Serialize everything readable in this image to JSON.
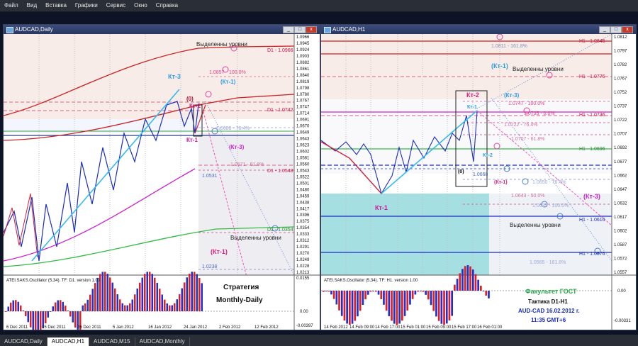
{
  "menu": [
    "Файл",
    "Вид",
    "Вставка",
    "Графики",
    "Сервис",
    "Окно",
    "Справка"
  ],
  "left": {
    "title": "AUDCAD,Daily",
    "price_labels": [
      "1.0966",
      "1.0945",
      "1.0924",
      "1.0903",
      "1.0882",
      "1.0861",
      "1.0840",
      "1.0819",
      "1.0798",
      "1.0780",
      "1.0767",
      "1.0747",
      "1.0714",
      "1.0691",
      "1.0670",
      "1.0649",
      "1.0643",
      "1.0623",
      "1.0602",
      "1.0581",
      "1.0560",
      "1.0543",
      "1.0522",
      "1.0501",
      "1.0480",
      "1.0459",
      "1.0438",
      "1.0417",
      "1.0396",
      "1.0375",
      "1.0354",
      "1.0333",
      "1.0312",
      "1.0291",
      "1.0270",
      "1.0249",
      "1.0228",
      "1.0213"
    ],
    "date_labels": [
      "6 Dec 2011",
      "15 Dec 2011",
      "26 Dec 2011",
      "5 Jan 2012",
      "16 Jan 2012",
      "24 Jan 2012",
      "2 Feb 2012",
      "12 Feb 2012"
    ],
    "ann": {
      "vydelen_top": "Выделенны уровни",
      "d1_0966": "D1 - 1.0966",
      "val_0857": "1.0857",
      "pct_100": "100.0%",
      "kt3": "Кт-3",
      "kt1_cyan": "(Кт-1)",
      "o_label": "(0)",
      "kt2": "Кт-2",
      "d1_0742": "D1 - 1.0742",
      "val_0680": "1.0680 - 76.4%",
      "kt1_mag": "Кт-1",
      "kt3_paren": "(Кт-3)",
      "val_0571": "1.0571 - 61.8%",
      "d1_0548": "D1 - 1.0548",
      "val_0531": "1.0531",
      "d1_0354": "D1 - 1.0354",
      "vydelen_bot": "Выделенны уровни",
      "kt1_paren": "(Кт-1)",
      "val_0238": "1.0238"
    },
    "osc_title": "ATEI.SAKS.Oscillator (5,34). TF: D1. version 1.00",
    "osc_scale": [
      "0.0155",
      "0.00",
      "-0.00397"
    ],
    "strategy1": "Стратегия",
    "strategy2": "Monthly-Daily"
  },
  "right": {
    "title": "AUDCAD,H1",
    "price_labels": [
      "1.0812",
      "1.0797",
      "1.0782",
      "1.0767",
      "1.0752",
      "1.0737",
      "1.0722",
      "1.0707",
      "1.0692",
      "1.0677",
      "1.0662",
      "1.0647",
      "1.0632",
      "1.0617",
      "1.0602",
      "1.0587",
      "1.0572",
      "1.0557"
    ],
    "date_labels": [
      "14 Feb 2012",
      "14 Feb 09:00",
      "14 Feb 17:00",
      "15 Feb 01:00",
      "15 Feb 09:00",
      "15 Feb 17:00",
      "16 Feb 01:00"
    ],
    "ann": {
      "val_0811": "1.0811 - 161.8%",
      "h1_0845": "H1 - 1.0845",
      "kt1_cyan": "(Кт-1)",
      "vydelen_top": "Выделенны уровни",
      "h1_0776": "H1 - 1.0776",
      "kt2": "Кт-2",
      "kt3_paren": "(Кт-3)",
      "kt1_lbl": "Кт-1",
      "val_0747": "1.0747 - 100.0%",
      "val_0735": "1.0735 - 0.0%",
      "h1_0736": "H1 - 1.0736",
      "val_0722": "1.0722 - 76.4%",
      "val_0707": "1.0707 - 61.8%",
      "h1_0696": "H1 - 1.0696",
      "kt2_b": "Кт-2",
      "o_label": "(0)",
      "val_0668": "1.0668",
      "kt1_paren": "(Кт-1)",
      "val_0650": "1.0650 - 76.4%",
      "val_0643": "1.0643 - 50.0%",
      "kt3_mag": "(Кт-3)",
      "val_0635": "1.0635 - 100.0%",
      "kt1_bottom": "Кт-1",
      "h1_0616": "H1 - 1.0616",
      "vydelen_bot": "Выделенны уровни",
      "val_0565": "1.0565 - 161.8%",
      "h1_0576": "H1 - 1.0576"
    },
    "osc_title": "ATEI.SAKS.Oscillator (5,34). TF: H1. version 1.00",
    "osc_scale": [
      "0.00",
      "-0.00331"
    ],
    "info1": "Факультет ГОСТ",
    "info2": "Тактика  D1-H1",
    "info3": "AUD-CAD 16.02.2012 г.",
    "info4": "11:35  GMT+6"
  },
  "tabs": [
    "AUDCAD,Daily",
    "AUDCAD,H1",
    "AUDCAD,M15",
    "AUDCAD,Monthly"
  ]
}
